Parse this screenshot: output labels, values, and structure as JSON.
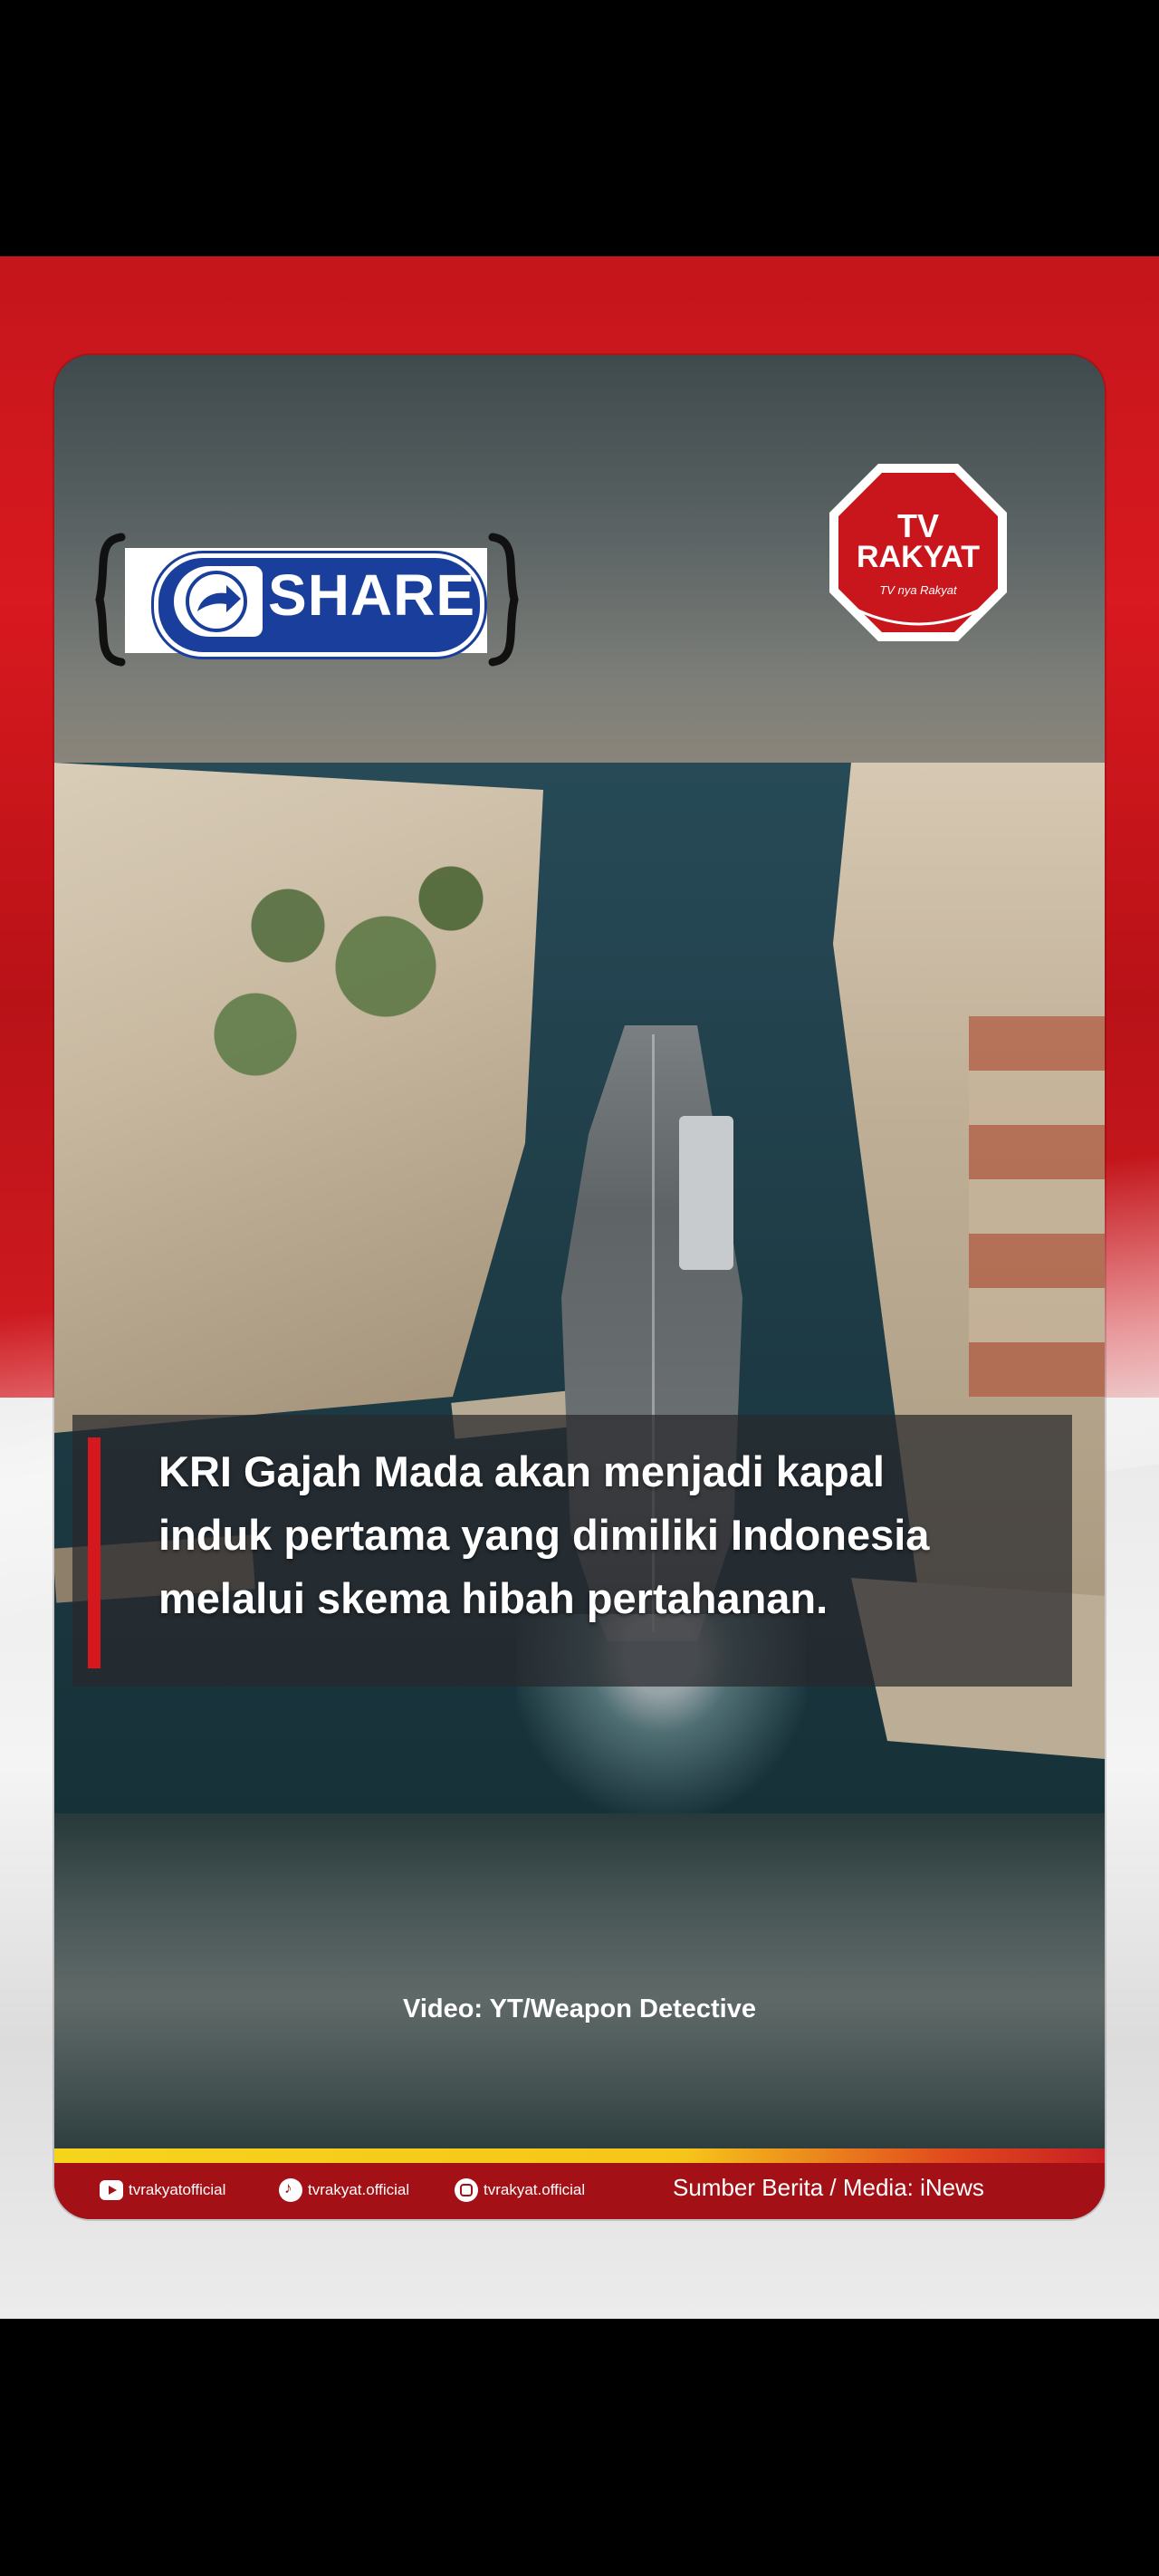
{
  "share": {
    "label": "SHARE"
  },
  "logo": {
    "line1": "TV",
    "line2": "RAKYAT",
    "tagline": "TV nya Rakyat"
  },
  "caption": {
    "line1": "KRI Gajah Mada akan menjadi kapal",
    "line2": "induk pertama yang dimiliki Indonesia",
    "line3": "melalui skema hibah pertahanan."
  },
  "video_credit": "Video: YT/Weapon Detective",
  "footer": {
    "socials": [
      {
        "platform": "youtube-icon",
        "handle": "tvrakyatofficial"
      },
      {
        "platform": "tiktok-icon",
        "handle": "tvrakyat.official"
      },
      {
        "platform": "instagram-icon",
        "handle": "tvrakyat.official"
      }
    ],
    "source": "Sumber Berita / Media: iNews"
  },
  "colors": {
    "brand_red": "#d4181e",
    "share_blue": "#1a3e9b",
    "stripe_yellow": "#f6d41c"
  }
}
